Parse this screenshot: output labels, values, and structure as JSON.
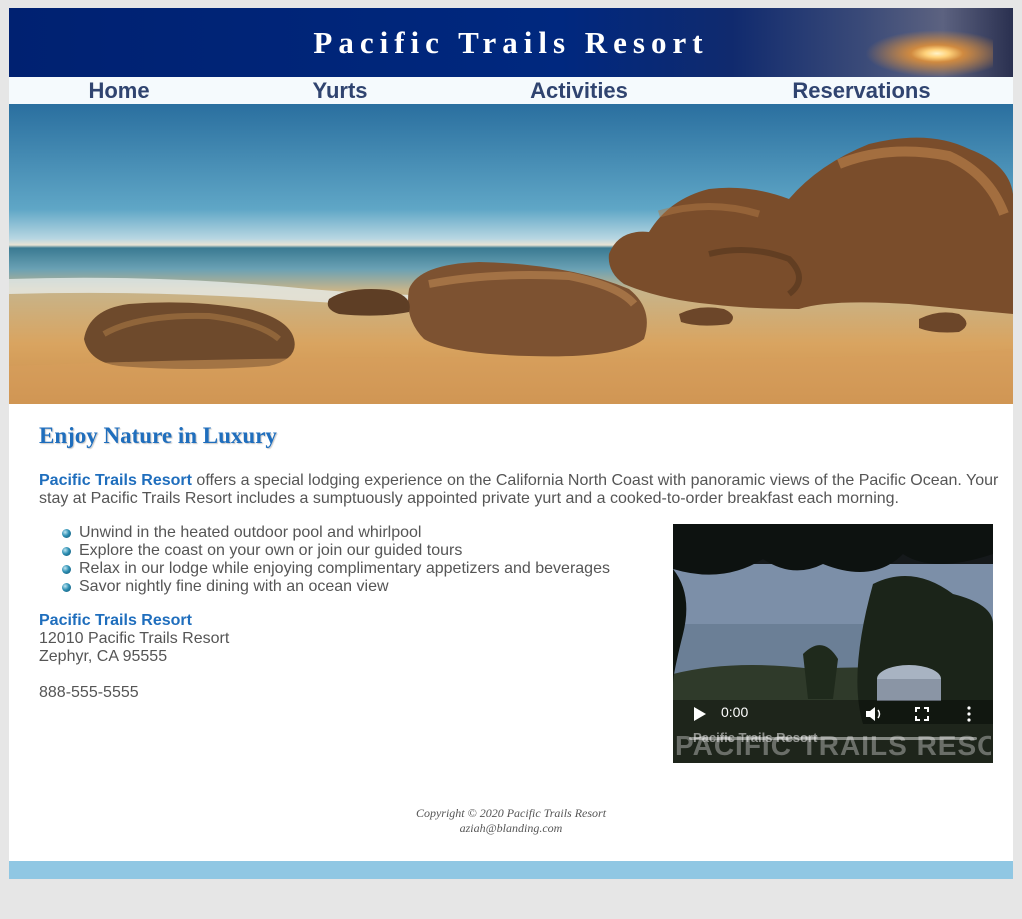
{
  "site": {
    "title": "Pacific Trails Resort"
  },
  "nav": {
    "items": [
      {
        "label": "Home"
      },
      {
        "label": "Yurts"
      },
      {
        "label": "Activities"
      },
      {
        "label": "Reservations"
      }
    ]
  },
  "hero": {
    "image": "beach-rocks-ocean"
  },
  "main": {
    "heading": "Enjoy Nature in Luxury",
    "intro_brand": "Pacific Trails Resort",
    "intro_text": " offers a special lodging experience on the California North Coast with panoramic views of the Pacific Ocean. Your stay at Pacific Trails Resort includes a sumptuously appointed private yurt and a cooked-to-order breakfast each morning.",
    "features": [
      "Unwind in the heated outdoor pool and whirlpool",
      "Explore the coast on your own or join our guided tours",
      "Relax in our lodge while enjoying complimentary appetizers and beverages",
      "Savor nightly fine dining with an ocean view"
    ],
    "address": {
      "name": "Pacific Trails Resort",
      "street": "12010 Pacific Trails Resort",
      "city": "Zephyr, CA 95555",
      "phone": "888-555-5555"
    }
  },
  "video": {
    "time": "0:00",
    "watermark": "PACIFIC TRAILS RESORT",
    "watermark_small": "Pacific Trails Resort",
    "controls": [
      "play-icon",
      "volume-icon",
      "fullscreen-icon",
      "more-options-icon"
    ]
  },
  "footer": {
    "copyright": "Copyright © 2020 Pacific Trails Resort",
    "email": "aziah@blanding.com"
  },
  "colors": {
    "header_bg": "#002171",
    "brand_blue": "#1f6ebd",
    "nav_text": "#304470",
    "text_gray": "#555555",
    "bottom_bar": "#90c7e3",
    "page_bg": "#e6e6e6"
  }
}
